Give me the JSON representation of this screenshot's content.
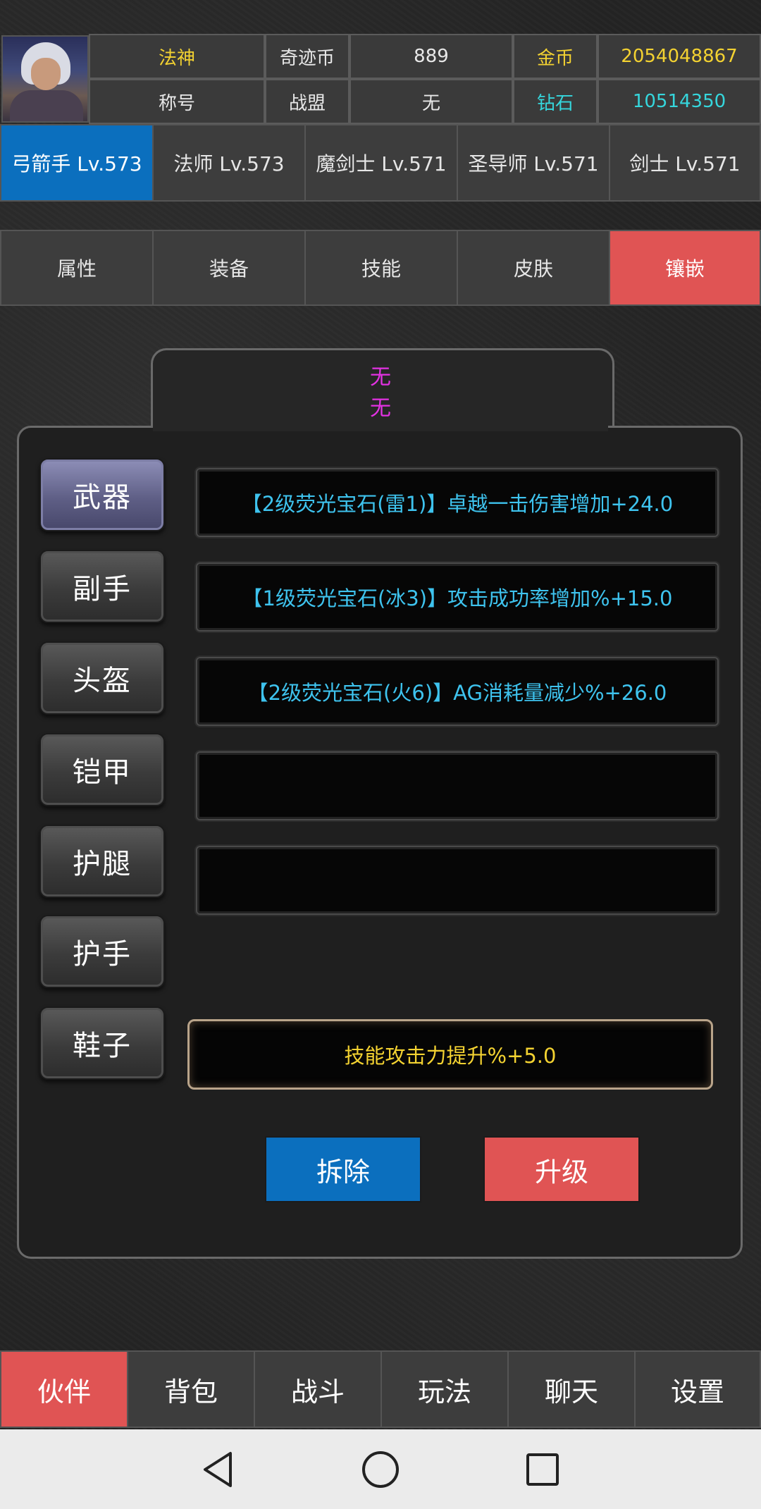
{
  "header": {
    "title_value": "法神",
    "title_label": "称号",
    "coin_label": "奇迹币",
    "coin_value": "889",
    "guild_label": "战盟",
    "guild_value": "无",
    "gold_label": "金币",
    "gold_value": "2054048867",
    "diamond_label": "钻石",
    "diamond_value": "10514350"
  },
  "class_tabs": [
    "弓箭手 Lv.573",
    "法师 Lv.573",
    "魔剑士 Lv.571",
    "圣导师 Lv.571",
    "剑士 Lv.571"
  ],
  "sub_tabs": [
    "属性",
    "装备",
    "技能",
    "皮肤",
    "镶嵌"
  ],
  "panel": {
    "top_text_1": "无",
    "top_text_2": "无",
    "slots": [
      "武器",
      "副手",
      "头盔",
      "铠甲",
      "护腿",
      "护手",
      "鞋子"
    ],
    "gems": [
      "【2级荧光宝石(雷1)】卓越一击伤害增加+24.0",
      "【1级荧光宝石(冰3)】攻击成功率增加%+15.0",
      "【2级荧光宝石(火6)】AG消耗量减少%+26.0",
      "",
      ""
    ],
    "bonus": "技能攻击力提升%+5.0",
    "remove_label": "拆除",
    "upgrade_label": "升级"
  },
  "bottom_nav": [
    "伙伴",
    "背包",
    "战斗",
    "玩法",
    "聊天",
    "设置"
  ],
  "colors": {
    "accent_blue": "#0b6fbe",
    "accent_red": "#e05454",
    "yellow_text": "#f3d231",
    "cyan_text": "#35d6dc",
    "gem_text": "#3ec3ee",
    "magenta_text": "#e232e2"
  },
  "icons": {
    "avatar": "character-portrait",
    "system_back": "back-triangle-icon",
    "system_home": "home-circle-icon",
    "system_recent": "recent-square-icon"
  }
}
